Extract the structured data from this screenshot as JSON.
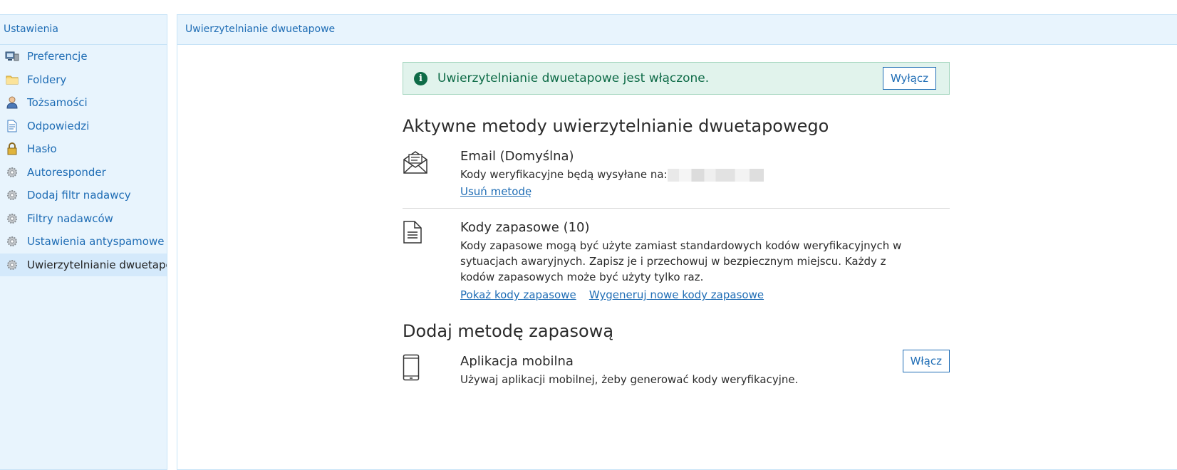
{
  "sidebar": {
    "title": "Ustawienia",
    "items": [
      {
        "label": "Preferencje",
        "icon": "preferences-icon",
        "active": false
      },
      {
        "label": "Foldery",
        "icon": "folder-icon",
        "active": false
      },
      {
        "label": "Tożsamości",
        "icon": "identity-icon",
        "active": false
      },
      {
        "label": "Odpowiedzi",
        "icon": "document-icon",
        "active": false
      },
      {
        "label": "Hasło",
        "icon": "lock-icon",
        "active": false
      },
      {
        "label": "Autoresponder",
        "icon": "gear-icon",
        "active": false
      },
      {
        "label": "Dodaj filtr nadawcy",
        "icon": "gear-icon",
        "active": false
      },
      {
        "label": "Filtry nadawców",
        "icon": "gear-icon",
        "active": false
      },
      {
        "label": "Ustawienia antyspamowe",
        "icon": "gear-icon",
        "active": false
      },
      {
        "label": "Uwierzytelnianie dwuetapowe",
        "icon": "gear-icon",
        "active": true
      }
    ]
  },
  "main": {
    "header": "Uwierzytelnianie dwuetapowe",
    "notice": {
      "text": "Uwierzytelnianie dwuetapowe jest włączone.",
      "button": "Wyłącz",
      "icon": "info-icon",
      "color": "#0e6b47"
    },
    "active_title": "Aktywne metody uwierzytelnianie dwuetapowego",
    "methods": {
      "email": {
        "title": "Email (Domyślna)",
        "desc": "Kody weryfikacyjne będą wysyłane na:",
        "link": "Usuń metodę",
        "icon": "envelope-icon"
      },
      "backup": {
        "title": "Kody zapasowe (10)",
        "desc": "Kody zapasowe mogą być użyte zamiast standardowych kodów weryfikacyjnych w sytuacjach awaryjnych. Zapisz je i przechowuj w bezpiecznym miejscu. Każdy z kodów zapasowych może być użyty tylko raz.",
        "link_show": "Pokaż kody zapasowe",
        "link_regen": "Wygeneruj nowe kody zapasowe",
        "icon": "file-icon"
      }
    },
    "add_title": "Dodaj metodę zapasową",
    "mobile": {
      "title": "Aplikacja mobilna",
      "desc": "Używaj aplikacji mobilnej, żeby generować kody weryfikacyjne.",
      "button": "Włącz",
      "icon": "phone-icon"
    }
  },
  "colors": {
    "accent": "#1f6db5",
    "sidebar_bg": "#e8f4fd",
    "success_bg": "#e1f3ec"
  }
}
